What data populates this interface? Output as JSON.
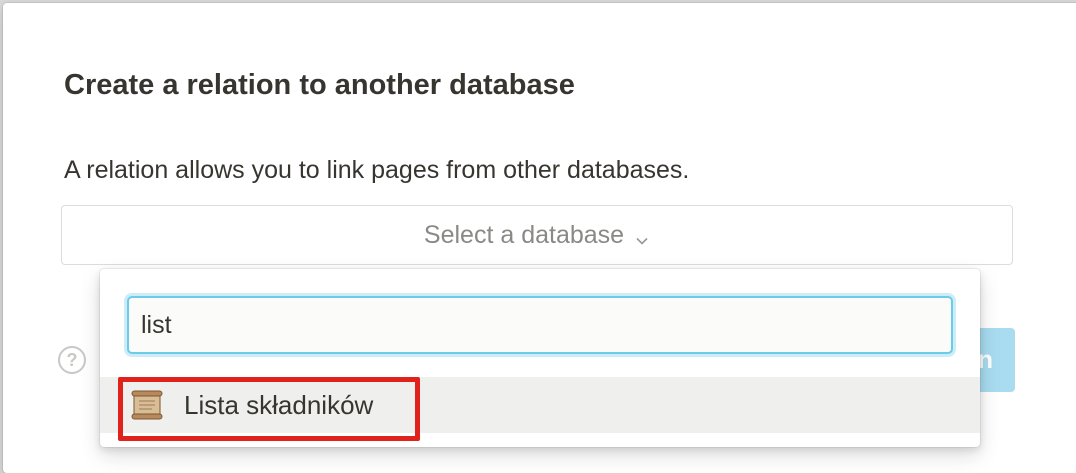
{
  "modal": {
    "title": "Create a relation to another database",
    "description": "A relation allows you to link pages from other databases.",
    "select_placeholder": "Select a database",
    "help_glyph": "?",
    "create_button_partial": "n"
  },
  "dropdown": {
    "search_value": "list",
    "results": [
      {
        "label": "Lista składników",
        "icon": "scroll-icon"
      }
    ]
  },
  "colors": {
    "accent": "#6ccbe9",
    "button_disabled": "#a9dcf1",
    "annotation": "#e0221d",
    "selected_row": "#efefee"
  }
}
